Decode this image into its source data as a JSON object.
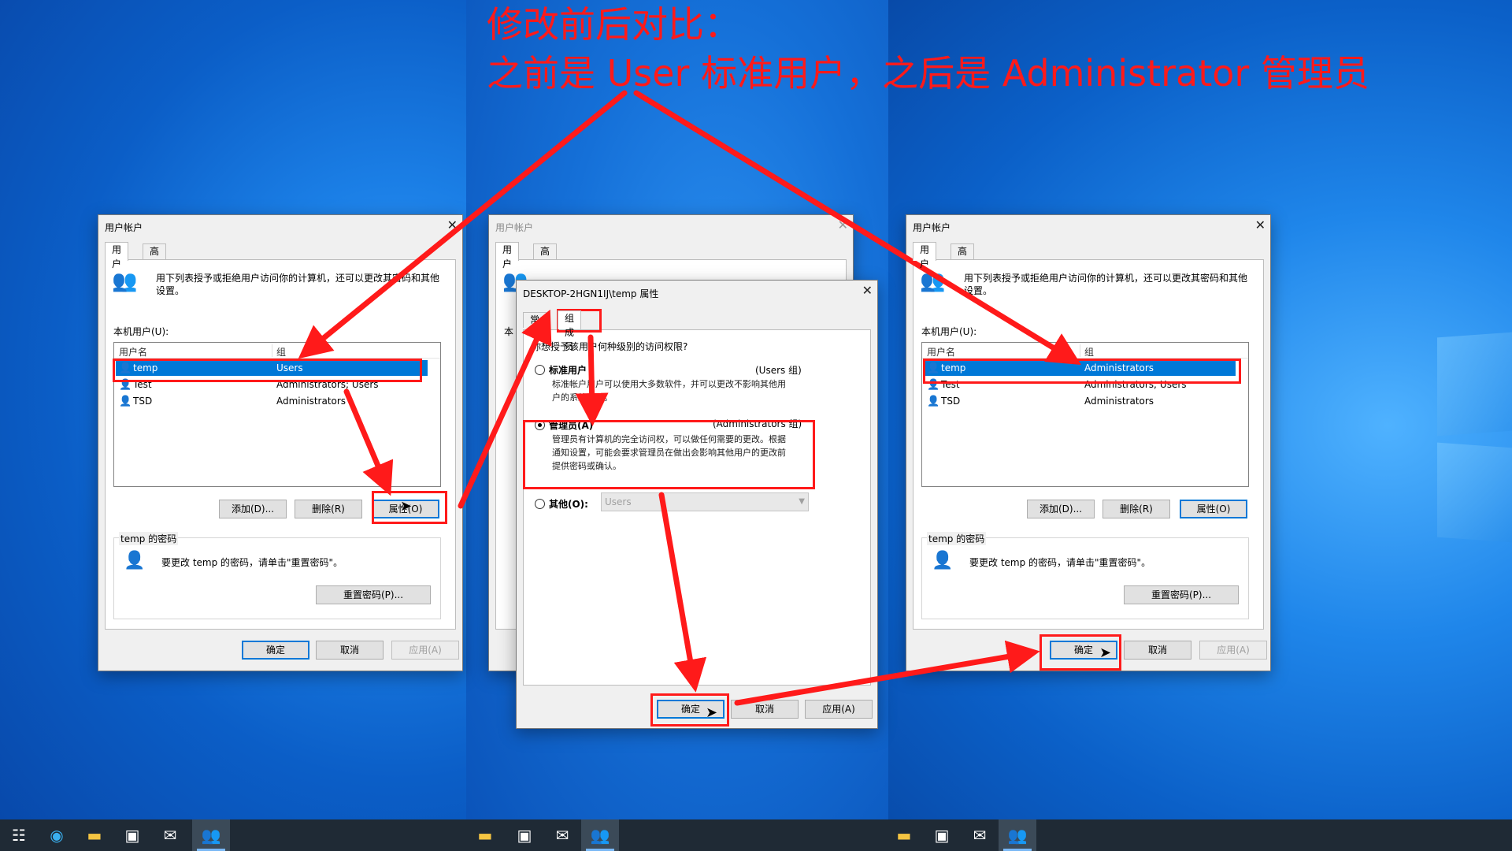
{
  "headline": {
    "line1": "修改前后对比：",
    "line2": "之前是 User 标准用户，之后是 Administrator 管理员"
  },
  "colors": {
    "annotation_red": "#ff1a1a",
    "selection_blue": "#0078d7",
    "taskbar": "#1f2a35"
  },
  "ua_left": {
    "title": "用户帐户",
    "tabs": [
      "用户",
      "高级"
    ],
    "intro": [
      "用下列表授予或拒绝用户访问你的计算机，还可以更改其密码和其他",
      "设置。"
    ],
    "local_users_label": "本机用户(U):",
    "columns": [
      "用户名",
      "组"
    ],
    "rows": [
      {
        "name": "temp",
        "group": "Users"
      },
      {
        "name": "Test",
        "group": "Administrators; Users"
      },
      {
        "name": "TSD",
        "group": "Administrators"
      }
    ],
    "buttons": {
      "add": "添加(D)...",
      "remove": "删除(R)",
      "properties": "属性(O)"
    },
    "password_group": "temp 的密码",
    "password_text": "要更改 temp 的密码，请单击\"重置密码\"。",
    "reset_button": "重置密码(P)...",
    "footer": {
      "ok": "确定",
      "cancel": "取消",
      "apply": "应用(A)"
    }
  },
  "ua_back": {
    "title": "用户帐户",
    "tabs": [
      "用户",
      "高级"
    ],
    "partial_label": "本"
  },
  "props": {
    "title": "DESKTOP-2HGN1IJ\\temp 属性",
    "tabs": [
      "常规",
      "组成员"
    ],
    "question": "你想授予该用户何种级别的访问权限?",
    "standard": {
      "label": "标准用户",
      "group": "(Users 组)",
      "desc": [
        "标准帐户用户可以使用大多数软件，并可以更改不影响其他用",
        "户的系统设置。"
      ]
    },
    "admin": {
      "label": "管理员(A)",
      "group": "(Administrators 组)",
      "desc": [
        "管理员有计算机的完全访问权，可以做任何需要的更改。根据",
        "通知设置，可能会要求管理员在做出会影响其他用户的更改前",
        "提供密码或确认。"
      ]
    },
    "other": {
      "label": "其他(O):",
      "value": "Users"
    },
    "footer": {
      "ok": "确定",
      "cancel": "取消",
      "apply": "应用(A)"
    }
  },
  "ua_right": {
    "title": "用户帐户",
    "tabs": [
      "用户",
      "高级"
    ],
    "intro": [
      "用下列表授予或拒绝用户访问你的计算机，还可以更改其密码和其他",
      "设置。"
    ],
    "local_users_label": "本机用户(U):",
    "columns": [
      "用户名",
      "组"
    ],
    "rows": [
      {
        "name": "temp",
        "group": "Administrators"
      },
      {
        "name": "Test",
        "group": "Administrators; Users"
      },
      {
        "name": "TSD",
        "group": "Administrators"
      }
    ],
    "buttons": {
      "add": "添加(D)...",
      "remove": "删除(R)",
      "properties": "属性(O)"
    },
    "password_group": "temp 的密码",
    "password_text": "要更改 temp 的密码，请单击\"重置密码\"。",
    "reset_button": "重置密码(P)...",
    "footer": {
      "ok": "确定",
      "cancel": "取消",
      "apply": "应用(A)"
    }
  },
  "taskbar_icons": [
    "task-view-icon",
    "edge-icon",
    "file-explorer-icon",
    "store-icon",
    "mail-icon",
    "user-accounts-icon"
  ]
}
